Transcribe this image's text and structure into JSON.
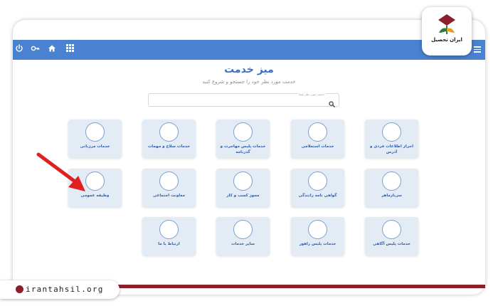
{
  "logo": {
    "text": "ایران تحصیل"
  },
  "website": "irantahsil.org",
  "header": {
    "icons": [
      "power-icon",
      "key-icon",
      "home-icon",
      "grid-icon"
    ],
    "menu_icon": "hamburger-menu-icon"
  },
  "page": {
    "title": "میز خدمت",
    "subtitle": "خدمت مورد نظر خود را جستجو و شروع کنید"
  },
  "search": {
    "label": "خدمت مورد نظر شما"
  },
  "services": [
    "احراز اطلاعات فردی و آدرس",
    "خدمات استعلامی",
    "خدمات پلیس مهاجرت و گذرنامه",
    "خدمات سلاح و مهمات",
    "خدمات مرزبانی",
    "سربازماهر",
    "گواهی نامه رانندگی",
    "مجوز کسب و کار",
    "معاونت اجتماعی",
    "وظیفه عمومی",
    "خدمات پلیس آگاهی",
    "خدمات پلیس راهور",
    "سایر خدمات",
    "ارتباط با ما"
  ],
  "colors": {
    "navbar": "#4a82d1",
    "title": "#3b6fc6",
    "card_bg": "#e3ebf5",
    "accent_red": "#8b1f2a",
    "arrow": "#e02020"
  }
}
